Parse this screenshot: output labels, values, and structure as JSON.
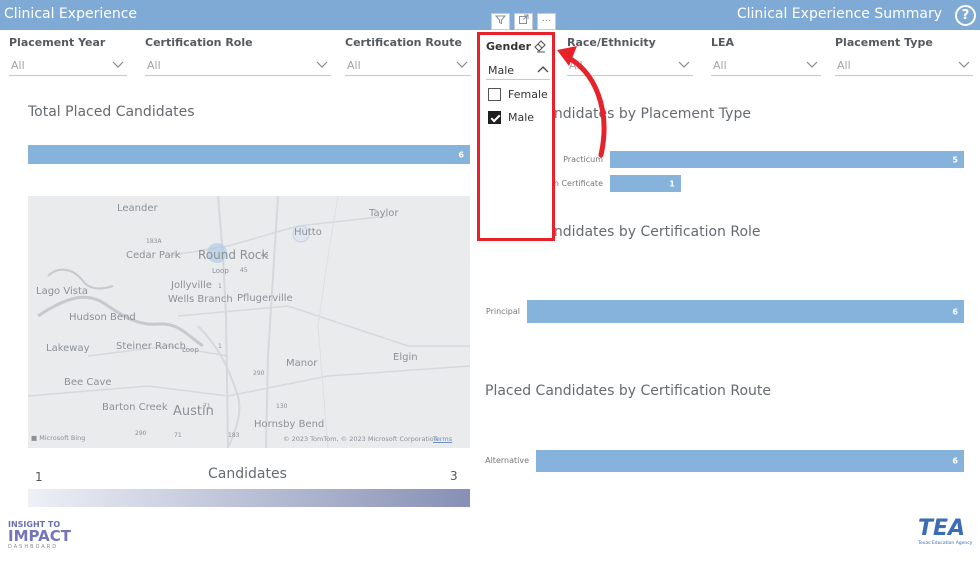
{
  "header": {
    "title_left": "Clinical Experience",
    "title_right": "Clinical Experience Summary",
    "help_icon": "question-circle-icon"
  },
  "visual_header_icons": [
    "filter-icon",
    "focus-mode-icon",
    "more-options-icon"
  ],
  "slicers": [
    {
      "label": "Placement Year",
      "value": "All"
    },
    {
      "label": "Certification Role",
      "value": "All"
    },
    {
      "label": "Certification Route",
      "value": "All"
    },
    {
      "label": "Race/Ethnicity",
      "value": "All"
    },
    {
      "label": "LEA",
      "value": "All"
    },
    {
      "label": "Placement Type",
      "value": "All"
    }
  ],
  "gender_slicer": {
    "label": "Gender",
    "value": "Male",
    "options": [
      {
        "label": "Female",
        "checked": false
      },
      {
        "label": "Male",
        "checked": true
      }
    ],
    "highlight_color": "#e8222a"
  },
  "total": {
    "title": "Total Placed Candidates",
    "value": "6"
  },
  "placement_type": {
    "title": "Placed Candidates by Placement Type",
    "chart_data": {
      "type": "bar",
      "orientation": "horizontal",
      "categories": [
        "Practicum",
        "Intern Certificate"
      ],
      "values": [
        5,
        1
      ],
      "xlim": [
        0,
        5
      ]
    }
  },
  "cert_role": {
    "title": "Placed Candidates by Certification Role",
    "chart_data": {
      "type": "bar",
      "orientation": "horizontal",
      "categories": [
        "Principal"
      ],
      "values": [
        6
      ],
      "xlim": [
        0,
        6
      ]
    }
  },
  "cert_route": {
    "title": "Placed Candidates by Certification Route",
    "chart_data": {
      "type": "bar",
      "orientation": "horizontal",
      "categories": [
        "Alternative"
      ],
      "values": [
        6
      ],
      "xlim": [
        0,
        6
      ]
    }
  },
  "map": {
    "places": [
      "Leander",
      "Taylor",
      "Hutto",
      "Cedar Park",
      "Round Rock",
      "Lago Vista",
      "Jollyville",
      "Wells Branch",
      "Pflugerville",
      "Hudson Bend",
      "Lakeway",
      "Steiner Ranch",
      "Elgin",
      "Manor",
      "Bee Cave",
      "Barton Creek",
      "Austin",
      "Hornsby Bend"
    ],
    "road_labels": [
      "183A",
      "45",
      "45",
      "1",
      "Loop",
      "Loop",
      "1",
      "290",
      "130",
      "71",
      "183",
      "290",
      "71"
    ],
    "attribution_left": "Microsoft Bing",
    "attribution_right": "© 2023 TomTom, © 2023 Microsoft Corporation",
    "terms_link": "Terms"
  },
  "legend": {
    "title": "Candidates",
    "min": "1",
    "max": "3",
    "color_start": "#eef0f6",
    "color_end": "#8790b5"
  },
  "logos": {
    "left_line1": "INSIGHT TO",
    "left_line2": "IMPACT",
    "left_line3": "DASHBOARD",
    "right_main": "TEA",
    "right_sub": "Texas Education Agency"
  },
  "colors": {
    "header": "#80aad6",
    "bar": "#86b3dc"
  }
}
